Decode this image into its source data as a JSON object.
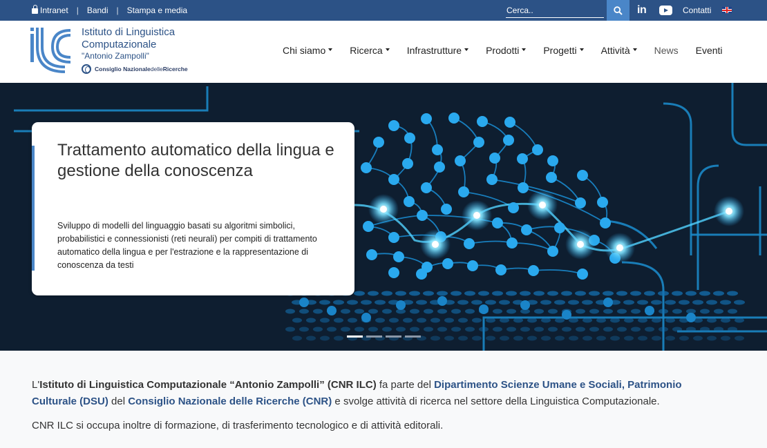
{
  "topbar": {
    "intranet": "Intranet",
    "bandi": "Bandi",
    "stampa": "Stampa e media",
    "search_placeholder": "Cerca..",
    "linkedin": "in",
    "contatti": "Contatti"
  },
  "header": {
    "org_line1": "Istituto di Linguistica",
    "org_line2": "Computazionale",
    "org_line3": "\"Antonio Zampolli\"",
    "cnr_a": "Consiglio Nazionale ",
    "cnr_b": "delle",
    "cnr_c": " Ricerche"
  },
  "nav": {
    "chi_siamo": "Chi siamo",
    "ricerca": "Ricerca",
    "infrastrutture": "Infrastrutture",
    "prodotti": "Prodotti",
    "progetti": "Progetti",
    "attivita": "Attività",
    "news": "News",
    "eventi": "Eventi"
  },
  "hero": {
    "title": "Trattamento automatico della lingua e gestione della conoscenza",
    "description": "Sviluppo di modelli del linguaggio basati su algoritmi simbolici, probabilistici e connessionisti (reti neurali) per compiti di trattamento automatico della lingua e per l'estrazione e la rappresentazione di conoscenza da testi",
    "slides_count": 4,
    "active_slide": 1
  },
  "intro": {
    "t1": "L'",
    "t2": "Istituto di Linguistica Computazionale “Antonio Zampolli” (CNR ILC)",
    "t3": " fa parte del ",
    "t4": "Dipartimento Scienze Umane e Sociali, Patrimonio Culturale (DSU)",
    "t5": " del ",
    "t6": "Consiglio Nazionale delle Ricerche (CNR)",
    "t7": " e svolge attività di ricerca nel settore della Linguistica Computazionale.",
    "p2": "CNR ILC si occupa inoltre di formazione, di trasferimento tecnologico e di attività editorali."
  },
  "colors": {
    "topbar_bg": "#2c5286",
    "accent": "#4a86c8",
    "hero_bg": "#0e1e30",
    "node": "#2aa9ee"
  }
}
